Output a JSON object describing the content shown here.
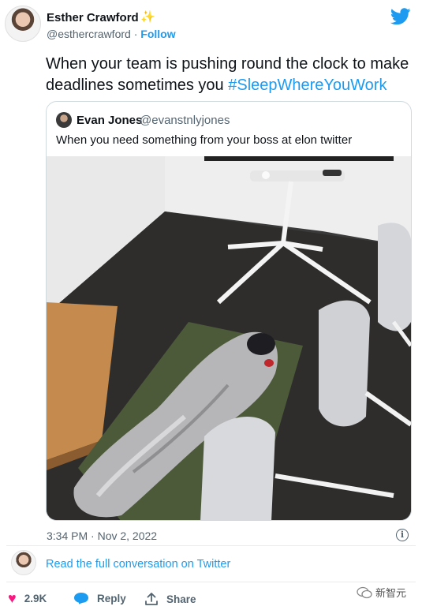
{
  "author": {
    "name": "Esther Crawford",
    "badge": "✨",
    "handle": "@esthercrawford",
    "separator": " · ",
    "follow": "Follow"
  },
  "tweet": {
    "text": "When your team is pushing round the clock to make deadlines sometimes you ",
    "hashtag": "#SleepWhereYouWork"
  },
  "quote": {
    "name": "Evan Jones",
    "handle": "@evanstnlyjones",
    "text": "When you need something from your boss at elon twitter"
  },
  "timestamp": "3:34 PM · Nov 2, 2022",
  "read_link": "Read the full conversation on Twitter",
  "actions": {
    "likes": "2.9K",
    "reply": "Reply",
    "share": "Share"
  },
  "watermark": "新智元",
  "colors": {
    "link": "#1d9bf0",
    "heart": "#f91880",
    "muted": "#536471"
  },
  "icons": [
    "twitter-bird-icon",
    "info-icon",
    "heart-icon",
    "reply-icon",
    "share-icon"
  ]
}
